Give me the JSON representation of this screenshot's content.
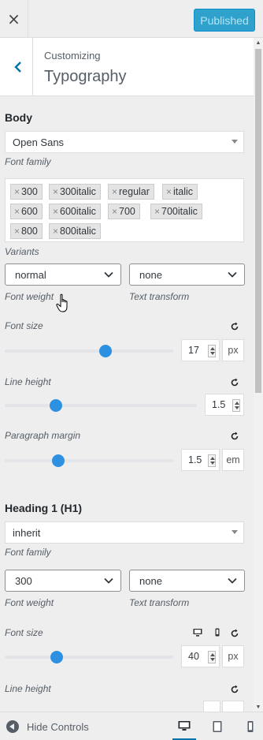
{
  "topbar": {
    "close_glyph": "×",
    "publish_label": "Published"
  },
  "header": {
    "crumb": "Customizing",
    "title": "Typography"
  },
  "body_section": {
    "heading": "Body",
    "font_value": "Open Sans",
    "font_label": "Font family",
    "variants": [
      "300",
      "300italic",
      "regular",
      "italic",
      "600",
      "600italic",
      "700",
      "700italic",
      "800",
      "800italic"
    ],
    "variants_label": "Variants",
    "weight_value": "normal",
    "weight_label": "Font weight",
    "transform_value": "none",
    "transform_label": "Text transform",
    "font_size_label": "Font size",
    "font_size_value": "17",
    "font_size_unit": "px",
    "line_height_label": "Line height",
    "line_height_value": "1.5",
    "para_margin_label": "Paragraph margin",
    "para_margin_value": "1.5",
    "para_margin_unit": "em"
  },
  "h1_section": {
    "heading": "Heading 1 (H1)",
    "font_value": "inherit",
    "font_label": "Font family",
    "weight_value": "300",
    "weight_label": "Font weight",
    "transform_value": "none",
    "transform_label": "Text transform",
    "font_size_label": "Font size",
    "font_size_value": "40",
    "font_size_unit": "px",
    "line_height_label": "Line height"
  },
  "footer": {
    "hide_label": "Hide Controls",
    "devices": [
      "desktop-icon",
      "tablet-icon",
      "mobile-icon"
    ],
    "active_device": "desktop"
  },
  "colors": {
    "accent": "#2e90e0",
    "publish_bg": "#2ea2cc",
    "link": "#0073aa"
  }
}
